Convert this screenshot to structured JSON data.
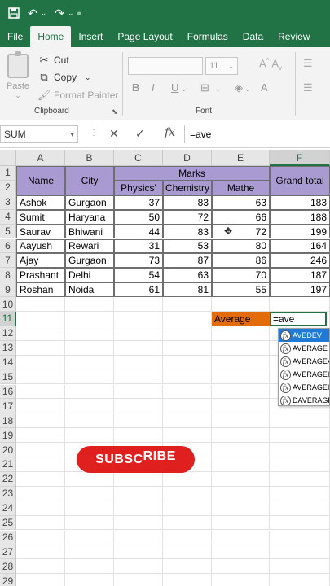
{
  "qat": {
    "save_icon": "save-icon",
    "undo_icon": "undo-icon",
    "redo_icon": "redo-icon"
  },
  "tabs": [
    "File",
    "Home",
    "Insert",
    "Page Layout",
    "Formulas",
    "Data",
    "Review"
  ],
  "active_tab": "Home",
  "clipboard": {
    "paste": "Paste",
    "cut": "Cut",
    "copy": "Copy",
    "format_painter": "Format Painter",
    "group_label": "Clipboard"
  },
  "font": {
    "size": "11",
    "group_label": "Font",
    "bold": "B",
    "italic": "I",
    "underline": "U"
  },
  "formula_bar": {
    "name_box": "SUM",
    "fx": "fx",
    "formula": "=ave"
  },
  "columns": [
    "A",
    "B",
    "C",
    "D",
    "E",
    "F"
  ],
  "selected_column": "F",
  "rows": [
    "1",
    "2",
    "3",
    "4",
    "5",
    "6",
    "7",
    "8",
    "9",
    "10",
    "11",
    "12",
    "13",
    "14",
    "15",
    "16",
    "17",
    "18",
    "19",
    "20",
    "21",
    "22",
    "23",
    "24",
    "25",
    "26",
    "27",
    "28",
    "29",
    "30"
  ],
  "selected_row": "11",
  "table": {
    "headers": {
      "name": "Name",
      "city": "City",
      "marks": "Marks",
      "physics": "Physics'",
      "chemistry": "Chemistry",
      "maths": "Mathe",
      "grand_total": "Grand total"
    },
    "rows": [
      {
        "name": "Ashok",
        "city": "Gurgaon",
        "physics": "37",
        "chemistry": "83",
        "maths": "63",
        "total": "183"
      },
      {
        "name": "Sumit",
        "city": "Haryana",
        "physics": "50",
        "chemistry": "72",
        "maths": "66",
        "total": "188"
      },
      {
        "name": "Saurav",
        "city": "Bhiwani",
        "physics": "44",
        "chemistry": "83",
        "maths": "72",
        "total": "199"
      },
      {
        "name": "Aayush",
        "city": "Rewari",
        "physics": "31",
        "chemistry": "53",
        "maths": "80",
        "total": "164"
      },
      {
        "name": "Ajay",
        "city": "Gurgaon",
        "physics": "73",
        "chemistry": "87",
        "maths": "86",
        "total": "246"
      },
      {
        "name": "Prashant",
        "city": "Delhi",
        "physics": "54",
        "chemistry": "63",
        "maths": "70",
        "total": "187"
      },
      {
        "name": "Roshan",
        "city": "Noida",
        "physics": "61",
        "chemistry": "81",
        "maths": "55",
        "total": "197"
      }
    ]
  },
  "average": {
    "label": "Average",
    "entry": "=ave"
  },
  "autocomplete": [
    "AVEDEV",
    "AVERAGE",
    "AVERAGEA",
    "AVERAGEIF",
    "AVERAGEIFS",
    "DAVERAGE"
  ],
  "subscribe": {
    "part1": "SUBSC",
    "part2": "RIBE"
  },
  "colors": {
    "excel_green": "#217346",
    "header_purple": "#a99bd1",
    "average_orange": "#e26b0a",
    "subscribe_red": "#e0201e",
    "selection_blue": "#1e7ad6"
  }
}
